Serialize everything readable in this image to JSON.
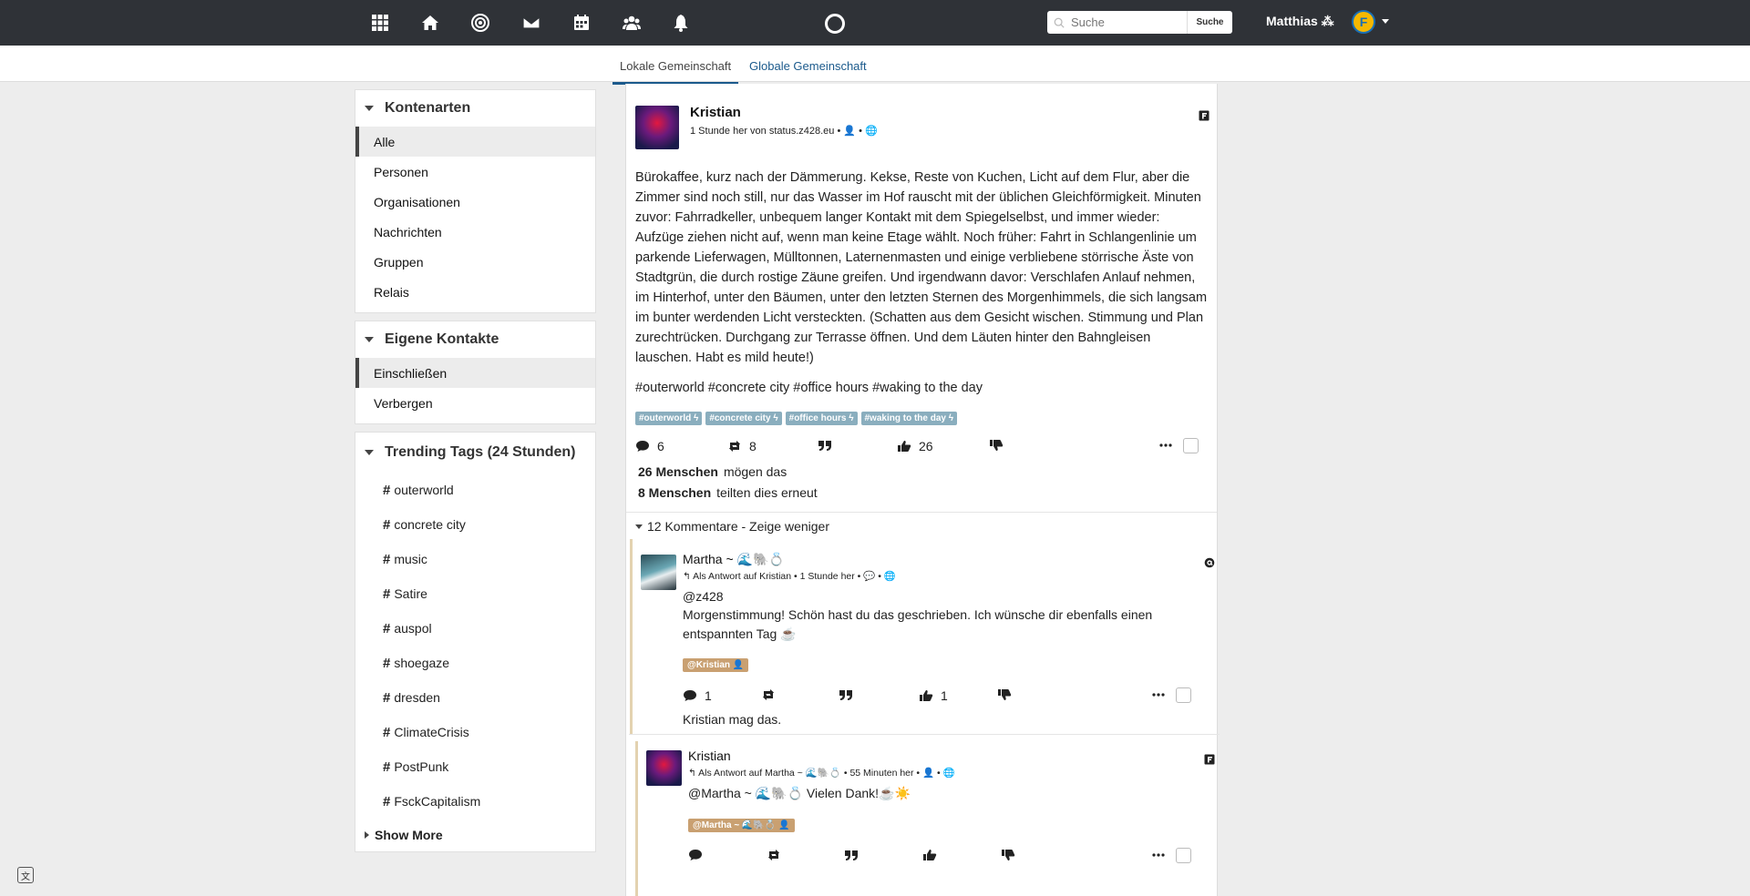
{
  "topnav": {
    "icons": [
      "apps-grid-icon",
      "home-icon",
      "network-icon",
      "mail-icon",
      "calendar-icon",
      "contacts-icon",
      "bell-icon"
    ],
    "search_placeholder": "Suche",
    "search_button": "Suche",
    "user_name": "Matthias ⁂",
    "avatar_letter": "F"
  },
  "tabs": [
    {
      "label": "Lokale Gemeinschaft",
      "active": true
    },
    {
      "label": "Globale Gemeinschaft",
      "active": false
    }
  ],
  "sidebar": {
    "account_types": {
      "title": "Kontenarten",
      "items": [
        "Alle",
        "Personen",
        "Organisationen",
        "Nachrichten",
        "Gruppen",
        "Relais"
      ],
      "selected": "Alle"
    },
    "own_contacts": {
      "title": "Eigene Kontakte",
      "items": [
        "Einschließen",
        "Verbergen"
      ],
      "selected": "Einschließen"
    },
    "trending": {
      "title": "Trending Tags (24 Stunden)",
      "tags": [
        "outerworld",
        "concrete city",
        "music",
        "Satire",
        "auspol",
        "shoegaze",
        "dresden",
        "ClimateCrisis",
        "PostPunk",
        "FsckCapitalism"
      ],
      "show_more": "Show More"
    }
  },
  "post": {
    "author": "Kristian",
    "meta": "1 Stunde her von status.z428.eu • 👤 • 🌐",
    "body": "Bürokaffee, kurz nach der Dämmerung. Kekse, Reste von Kuchen, Licht auf dem Flur, aber die Zimmer sind noch still, nur das Wasser im Hof rauscht mit der üblichen Gleichförmigkeit. Minuten zuvor: Fahrradkeller, unbequem langer Kontakt mit dem Spiegelselbst, und immer wieder: Aufzüge ziehen nicht auf, wenn man keine Etage wählt. Noch früher: Fahrt in Schlangenlinie um parkende Lieferwagen, Mülltonnen, Laternenmasten und einige verbliebene störrische Äste von Stadtgrün, die durch rostige Zäune greifen. Und irgendwann davor: Verschlafen Anlauf nehmen, im Hinterhof, unter den Bäumen, unter den letzten Sternen des Morgenhimmels, die sich langsam im bunter werdenden Licht versteckten. (Schatten aus dem Gesicht wischen. Stimmung und Plan zurechtrücken. Durchgang zur Terrasse öffnen. Und dem Läuten hinter den Bahngleisen lauschen. Habt es mild heute!)",
    "hashtags_line": "#outerworld #concrete city #office hours #waking to the day",
    "tag_pills": [
      "#outerworld ϟ",
      "#concrete city ϟ",
      "#office hours ϟ",
      "#waking to the day ϟ"
    ],
    "comments_count": "6",
    "reshares_count": "8",
    "likes_count": "26",
    "likes_people": "26 Menschen",
    "likes_text": "mögen das",
    "reshares_people": "8 Menschen",
    "reshares_text": "teilten dies erneut",
    "comments_toggle": "12 Kommentare - Zeige weniger"
  },
  "comments": [
    {
      "author": "Martha ~ 🌊🐘💍",
      "meta": "↰ Als Antwort auf Kristian • 1 Stunde her • 💬 • 🌐",
      "mention": "@z428",
      "text": "Morgenstimmung! Schön hast du das geschrieben. Ich wünsche dir ebenfalls einen entspannten Tag ☕",
      "pill": "@Kristian 👤",
      "comments_count": "1",
      "likes_count": "1",
      "liked_by": "Kristian mag das."
    },
    {
      "author": "Kristian",
      "meta": "↰ Als Antwort auf Martha ~ 🌊🐘💍 • 55 Minuten her • 👤 • 🌐",
      "text": "@Martha ~ 🌊🐘💍 Vielen Dank!☕☀️",
      "pill": "@Martha ~ 🌊🐘💍 👤"
    }
  ]
}
